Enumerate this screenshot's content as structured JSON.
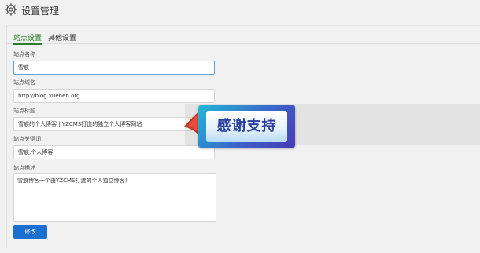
{
  "header": {
    "title": "设置管理",
    "icon": "gear-icon"
  },
  "tabs": [
    {
      "label": "站点设置",
      "active": true
    },
    {
      "label": "其他设置",
      "active": false
    }
  ],
  "form": {
    "site_name": {
      "label": "站点名称",
      "value": "雪痕"
    },
    "site_domain": {
      "label": "站点域名",
      "value": "http://blog.xuehen.org"
    },
    "site_title": {
      "label": "站点标题",
      "value": "雪痕的个人博客 | YZCMS打造的独立个人博客网站"
    },
    "site_keywords": {
      "label": "站点关键词",
      "value": "雪痕,个人博客"
    },
    "site_description": {
      "label": "站点描述",
      "value": "雪痕博客一个由YZCMS打造的个人独立博客！"
    },
    "submit_label": "修改"
  },
  "overlay": {
    "text": "感谢支持"
  },
  "colors": {
    "accent": "#2e7d32",
    "button": "#1a6fd0",
    "banner": "#3c5fc8"
  }
}
